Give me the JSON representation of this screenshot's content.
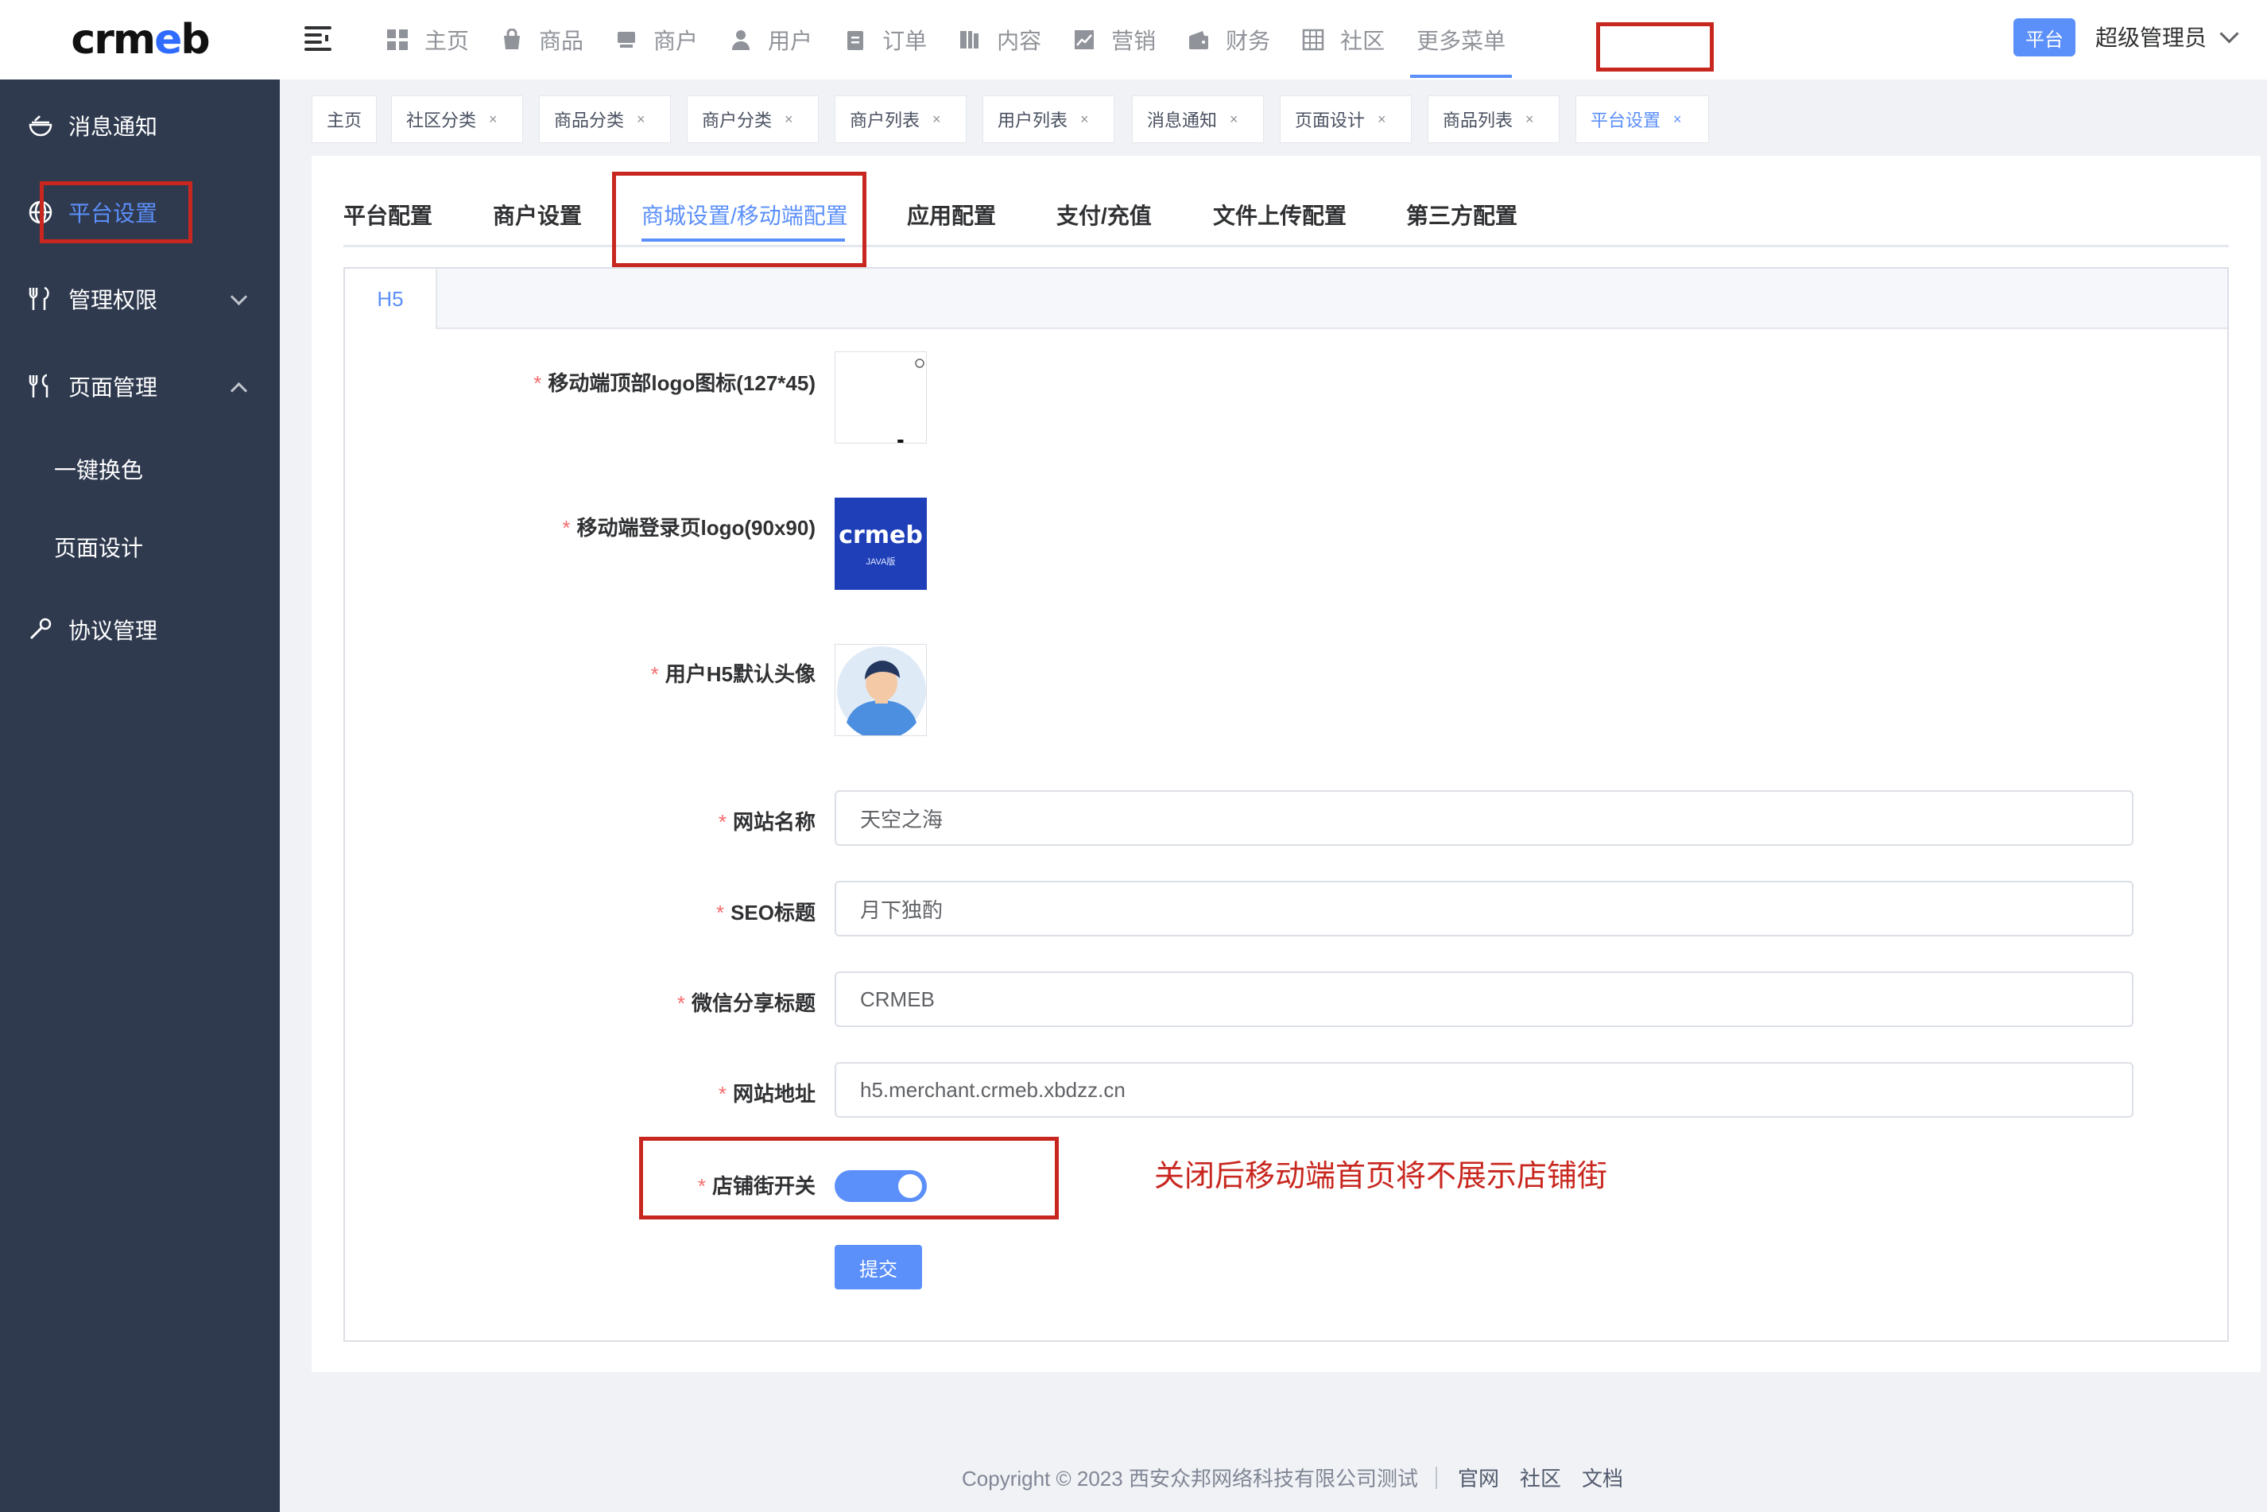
{
  "brand": {
    "logo_text_a": "crm",
    "logo_text_b": "e",
    "logo_text_c": "b"
  },
  "topnav": [
    {
      "label": "主页",
      "icon": "grid-icon"
    },
    {
      "label": "商品",
      "icon": "bag-icon"
    },
    {
      "label": "商户",
      "icon": "shop-icon"
    },
    {
      "label": "用户",
      "icon": "user-icon"
    },
    {
      "label": "订单",
      "icon": "clipboard-icon"
    },
    {
      "label": "内容",
      "icon": "book-icon"
    },
    {
      "label": "营销",
      "icon": "chart-icon"
    },
    {
      "label": "财务",
      "icon": "wallet-icon"
    },
    {
      "label": "社区",
      "icon": "building-icon"
    },
    {
      "label": "更多菜单",
      "icon": ""
    }
  ],
  "header": {
    "platform_label": "平台",
    "user_name": "超级管理员"
  },
  "sidebar": {
    "items": [
      {
        "label": "消息通知"
      },
      {
        "label": "平台设置"
      },
      {
        "label": "管理权限"
      },
      {
        "label": "页面管理"
      },
      {
        "label": "一键换色"
      },
      {
        "label": "页面设计"
      },
      {
        "label": "协议管理"
      }
    ]
  },
  "tags": [
    {
      "label": "主页",
      "closable": false
    },
    {
      "label": "社区分类",
      "closable": true
    },
    {
      "label": "商品分类",
      "closable": true
    },
    {
      "label": "商户分类",
      "closable": true
    },
    {
      "label": "商户列表",
      "closable": true
    },
    {
      "label": "用户列表",
      "closable": true
    },
    {
      "label": "消息通知",
      "closable": true
    },
    {
      "label": "页面设计",
      "closable": true
    },
    {
      "label": "商品列表",
      "closable": true
    },
    {
      "label": "平台设置",
      "closable": true
    }
  ],
  "tag_close": "×",
  "tabs": [
    "平台配置",
    "商户设置",
    "商城设置/移动端配置",
    "应用配置",
    "支付/充值",
    "文件上传配置",
    "第三方配置"
  ],
  "subtab": "H5",
  "form": {
    "required_mark": "*",
    "top_logo_label": "移动端顶部logo图标(127*45)",
    "login_logo_label": "移动端登录页logo(90x90)",
    "login_logo_text": "crmeb",
    "login_logo_sub": "JAVA版",
    "avatar_label": "用户H5默认头像",
    "site_name_label": "网站名称",
    "site_name_value": "天空之海",
    "seo_title_label": "SEO标题",
    "seo_title_value": "月下独酌",
    "wechat_share_label": "微信分享标题",
    "wechat_share_value": "CRMEB",
    "site_url_label": "网站地址",
    "site_url_value": "h5.merchant.crmeb.xbdzz.cn",
    "street_switch_label": "店铺街开关",
    "street_switch_on": true,
    "submit_label": "提交"
  },
  "annotation": "关闭后移动端首页将不展示店铺街",
  "footer": {
    "copyright": "Copyright © 2023 西安众邦网络科技有限公司测试",
    "links": [
      "官网",
      "社区",
      "文档"
    ]
  },
  "colors": {
    "accent": "#5b8ff9",
    "sidebar_bg": "#2f3a4f",
    "highlight": "#c8271f"
  }
}
